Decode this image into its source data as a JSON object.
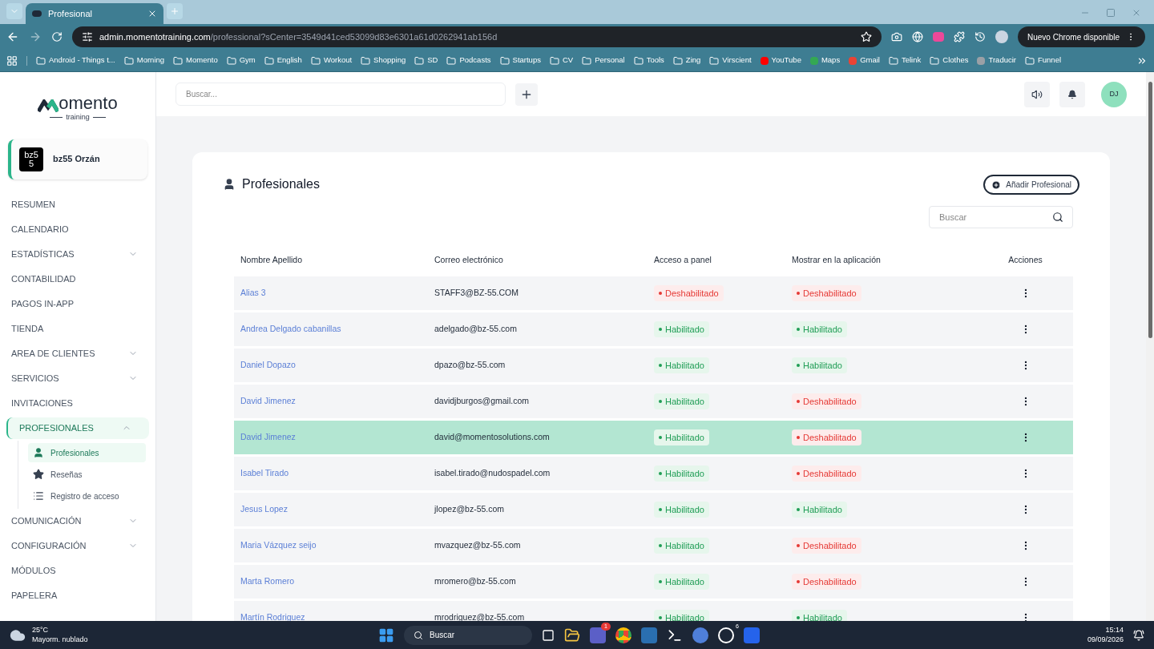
{
  "browser": {
    "tab": {
      "title": "Profesional"
    },
    "url": {
      "host": "admin.momentotraining.com",
      "path": "/professional?sCenter=3549d41ced53099d83e6301a61d0262941ab156d"
    },
    "update_button": "Nuevo Chrome disponible",
    "bookmarks": [
      {
        "label": "Android - Things t...",
        "kind": "folder"
      },
      {
        "label": "Morning",
        "kind": "folder"
      },
      {
        "label": "Momento",
        "kind": "folder"
      },
      {
        "label": "Gym",
        "kind": "folder"
      },
      {
        "label": "English",
        "kind": "folder"
      },
      {
        "label": "Workout",
        "kind": "folder"
      },
      {
        "label": "Shopping",
        "kind": "folder"
      },
      {
        "label": "SD",
        "kind": "folder"
      },
      {
        "label": "Podcasts",
        "kind": "folder"
      },
      {
        "label": "Startups",
        "kind": "folder"
      },
      {
        "label": "CV",
        "kind": "folder"
      },
      {
        "label": "Personal",
        "kind": "folder"
      },
      {
        "label": "Tools",
        "kind": "folder"
      },
      {
        "label": "Zing",
        "kind": "folder"
      },
      {
        "label": "Virscient",
        "kind": "folder"
      },
      {
        "label": "YouTube",
        "kind": "site",
        "color": "#ff0000"
      },
      {
        "label": "Maps",
        "kind": "site",
        "color": "#34a853"
      },
      {
        "label": "Gmail",
        "kind": "site",
        "color": "#ea4335"
      },
      {
        "label": "Telink",
        "kind": "folder"
      },
      {
        "label": "Clothes",
        "kind": "folder"
      },
      {
        "label": "Traducir",
        "kind": "site",
        "color": "#9aa0a6"
      },
      {
        "label": "Funnel",
        "kind": "folder"
      }
    ]
  },
  "topbar": {
    "search": {
      "placeholder": "Buscar..."
    },
    "avatar": "DJ"
  },
  "sidebar": {
    "logo": {
      "name": "omento",
      "tagline": "training"
    },
    "center": {
      "logo": "bz55",
      "name": "bz55 Orzán"
    },
    "items": [
      {
        "label": "RESUMEN",
        "selected": false
      },
      {
        "label": "CALENDARIO",
        "selected": false
      },
      {
        "label": "ESTADÍSTICAS",
        "expandable": true,
        "expanded": false,
        "selected": false
      },
      {
        "label": "CONTABILIDAD",
        "selected": false
      },
      {
        "label": "PAGOS IN-APP",
        "selected": false
      },
      {
        "label": "TIENDA",
        "selected": false
      },
      {
        "label": "AREA DE CLIENTES",
        "expandable": true,
        "expanded": false,
        "selected": false
      },
      {
        "label": "SERVICIOS",
        "expandable": true,
        "expanded": false,
        "selected": false
      },
      {
        "label": "INVITACIONES",
        "selected": false
      },
      {
        "label": "PROFESIONALES",
        "expandable": true,
        "expanded": true,
        "selected": true,
        "children": [
          {
            "label": "Profesionales",
            "kind": "person",
            "selected": true
          },
          {
            "label": "Reseñas",
            "kind": "star",
            "selected": false
          },
          {
            "label": "Registro de acceso",
            "kind": "list",
            "selected": false
          }
        ]
      },
      {
        "label": "COMUNICACIÓN",
        "expandable": true,
        "expanded": false,
        "selected": false
      },
      {
        "label": "CONFIGURACIÓN",
        "expandable": true,
        "expanded": false,
        "selected": false
      },
      {
        "label": "MÓDULOS",
        "selected": false
      },
      {
        "label": "PAPELERA",
        "selected": false
      }
    ]
  },
  "card": {
    "title": "Profesionales",
    "add_button": "Añadir Profesional",
    "search": {
      "placeholder": "Buscar"
    },
    "table": {
      "columns": [
        "Nombre Apellido",
        "Correo electrónico",
        "Acceso a panel",
        "Mostrar en la aplicación",
        "Acciones"
      ],
      "rows": [
        {
          "name": "Alias 3",
          "email": "STAFF3@BZ-55.COM",
          "panel": {
            "text": "Deshabilitado",
            "enabled": false
          },
          "app": {
            "text": "Deshabilitado",
            "enabled": false
          },
          "selected": false
        },
        {
          "name": "Andrea Delgado cabanillas",
          "email": "adelgado@bz-55.com",
          "panel": {
            "text": "Habilitado",
            "enabled": true
          },
          "app": {
            "text": "Habilitado",
            "enabled": true
          },
          "selected": false
        },
        {
          "name": "Daniel Dopazo",
          "email": "dpazo@bz-55.com",
          "panel": {
            "text": "Habilitado",
            "enabled": true
          },
          "app": {
            "text": "Habilitado",
            "enabled": true
          },
          "selected": false
        },
        {
          "name": "David Jimenez",
          "email": "davidjburgos@gmail.com",
          "panel": {
            "text": "Habilitado",
            "enabled": true
          },
          "app": {
            "text": "Deshabilitado",
            "enabled": false
          },
          "selected": false
        },
        {
          "name": "David Jimenez",
          "email": "david@momentosolutions.com",
          "panel": {
            "text": "Habilitado",
            "enabled": true
          },
          "app": {
            "text": "Deshabilitado",
            "enabled": false
          },
          "selected": true
        },
        {
          "name": "Isabel Tirado",
          "email": "isabel.tirado@nudospadel.com",
          "panel": {
            "text": "Habilitado",
            "enabled": true
          },
          "app": {
            "text": "Deshabilitado",
            "enabled": false
          },
          "selected": false
        },
        {
          "name": "Jesus Lopez",
          "email": "jlopez@bz-55.com",
          "panel": {
            "text": "Habilitado",
            "enabled": true
          },
          "app": {
            "text": "Habilitado",
            "enabled": true
          },
          "selected": false
        },
        {
          "name": "Maria Vázquez seijo",
          "email": "mvazquez@bz-55.com",
          "panel": {
            "text": "Habilitado",
            "enabled": true
          },
          "app": {
            "text": "Deshabilitado",
            "enabled": false
          },
          "selected": false
        },
        {
          "name": "Marta Romero",
          "email": "mromero@bz-55.com",
          "panel": {
            "text": "Habilitado",
            "enabled": true
          },
          "app": {
            "text": "Deshabilitado",
            "enabled": false
          },
          "selected": false
        },
        {
          "name": "Martín Rodriguez",
          "email": "mrodriguez@bz-55.com",
          "panel": {
            "text": "Habilitado",
            "enabled": true
          },
          "app": {
            "text": "Habilitado",
            "enabled": true
          },
          "selected": false
        }
      ]
    }
  },
  "taskbar": {
    "weather": {
      "temp": "25°C",
      "desc": "Mayorm. nublado"
    },
    "search": {
      "placeholder": "Buscar"
    },
    "badges": [
      {
        "text": "1"
      },
      {
        "text": "6"
      }
    ],
    "time": "15:14",
    "date": "09/09/2026"
  }
}
